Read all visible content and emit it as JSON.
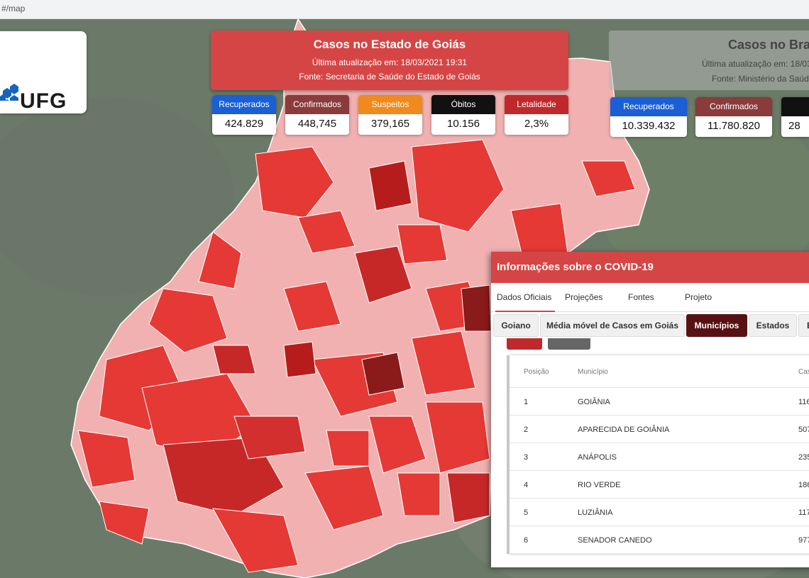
{
  "browser": {
    "url_fragment": "#/map"
  },
  "logo": {
    "text": "UFG"
  },
  "state": {
    "title": "Casos no Estado de Goiás",
    "updated": "Última atualização em: 18/03/2021 19:31",
    "source": "Fonte: Secretaria de Saúde do Estado de Goiás",
    "cards": [
      {
        "label": "Recuperados",
        "value": "424.829",
        "color": "#1a5fd6"
      },
      {
        "label": "Confirmados",
        "value": "448,745",
        "color": "#8a3b3b"
      },
      {
        "label": "Suspeitos",
        "value": "379,165",
        "color": "#f08a1c"
      },
      {
        "label": "Óbitos",
        "value": "10.156",
        "color": "#111111"
      },
      {
        "label": "Letalidade",
        "value": "2,3%",
        "color": "#c0292b"
      }
    ]
  },
  "brazil": {
    "title": "Casos no Bra",
    "updated": "Última atualização em: 18/03/",
    "source": "Fonte: Ministério da Saúde",
    "cards": [
      {
        "label": "Recuperados",
        "value": "10.339.432",
        "color": "#1a5fd6"
      },
      {
        "label": "Confirmados",
        "value": "11.780.820",
        "color": "#8a3b3b"
      },
      {
        "label": "",
        "value": "28",
        "color": "#111111"
      }
    ]
  },
  "panel": {
    "title": "Informações sobre o COVID-19",
    "tabs": [
      "Dados Oficiais",
      "Projeções",
      "Fontes",
      "Projeto"
    ],
    "subtabs": [
      "Goiano",
      "Média móvel de Casos em Goiás",
      "Municípios",
      "Estados",
      "E"
    ],
    "active_subtab": "Municípios",
    "table": {
      "headers": [
        "Posição",
        "Município",
        "Cas"
      ],
      "rows": [
        {
          "pos": "1",
          "name": "GOIÂNIA",
          "cases": "116"
        },
        {
          "pos": "2",
          "name": "APARECIDA DE GOIÂNIA",
          "cases": "507"
        },
        {
          "pos": "3",
          "name": "ANÁPOLIS",
          "cases": "235"
        },
        {
          "pos": "4",
          "name": "RIO VERDE",
          "cases": "186"
        },
        {
          "pos": "5",
          "name": "LUZIÂNIA",
          "cases": "117"
        },
        {
          "pos": "6",
          "name": "SENADOR CANEDO",
          "cases": "977"
        }
      ]
    }
  },
  "colors": {
    "accent": "#d64545",
    "active_tab": "#561212",
    "map_bg": "#6f7c6c"
  }
}
